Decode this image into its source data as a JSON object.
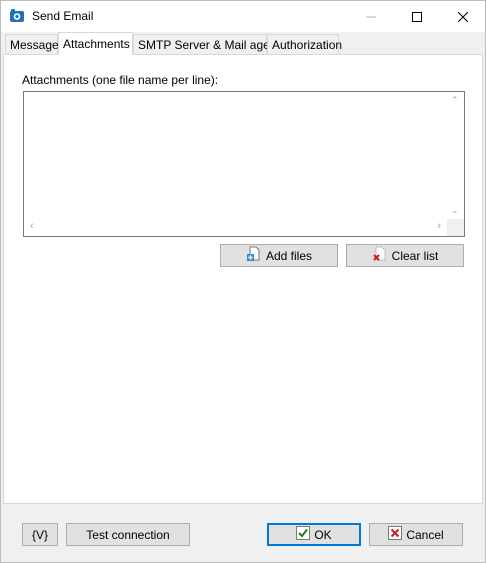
{
  "window": {
    "title": "Send Email"
  },
  "tabs": [
    {
      "label": "Message",
      "active": false
    },
    {
      "label": "Attachments",
      "active": true
    },
    {
      "label": "SMTP Server & Mail agent",
      "active": false
    },
    {
      "label": "Authorization",
      "active": false
    }
  ],
  "attachments": {
    "label": "Attachments (one file name per line):",
    "value": "",
    "add_files_label": "Add files",
    "clear_list_label": "Clear list"
  },
  "footer": {
    "variables_label": "{V}",
    "test_connection_label": "Test connection",
    "ok_label": "OK",
    "cancel_label": "Cancel"
  },
  "colors": {
    "ok_border": "#0078d7",
    "ok_check": "#1a7f1a",
    "cancel_x": "#d11d1d",
    "app_icon": "#1e73be"
  },
  "icons": {
    "app": "send-email-icon",
    "add_files": "add-file-icon",
    "clear_list": "clear-list-icon",
    "ok": "checkmark-icon",
    "cancel": "red-x-icon"
  }
}
